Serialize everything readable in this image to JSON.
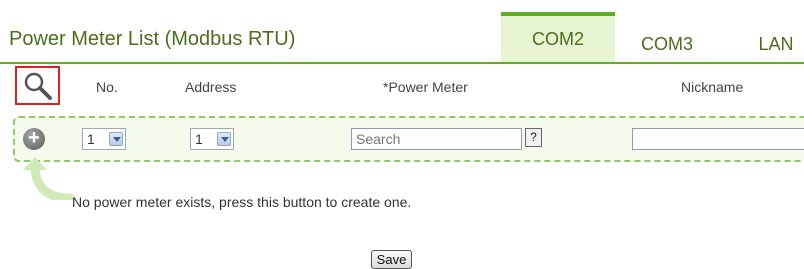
{
  "title": "Power Meter List (Modbus RTU)",
  "tabs": [
    {
      "label": "COM2",
      "active": true
    },
    {
      "label": "COM3",
      "active": false
    },
    {
      "label": "LAN",
      "active": false
    }
  ],
  "columns": {
    "no": "No.",
    "address": "Address",
    "power_meter": "*Power Meter",
    "nickname": "Nickname"
  },
  "new_row": {
    "no_value": "1",
    "address_value": "1",
    "power_meter_placeholder": "Search",
    "help_label": "?",
    "nickname_value": ""
  },
  "hint": "No power meter exists, press this button to create one.",
  "save_label": "Save",
  "colors": {
    "accent_green": "#5fae25",
    "title_green": "#4a6e1c",
    "active_tab_bg": "#e7f5d3",
    "highlight_red": "#e02020"
  }
}
